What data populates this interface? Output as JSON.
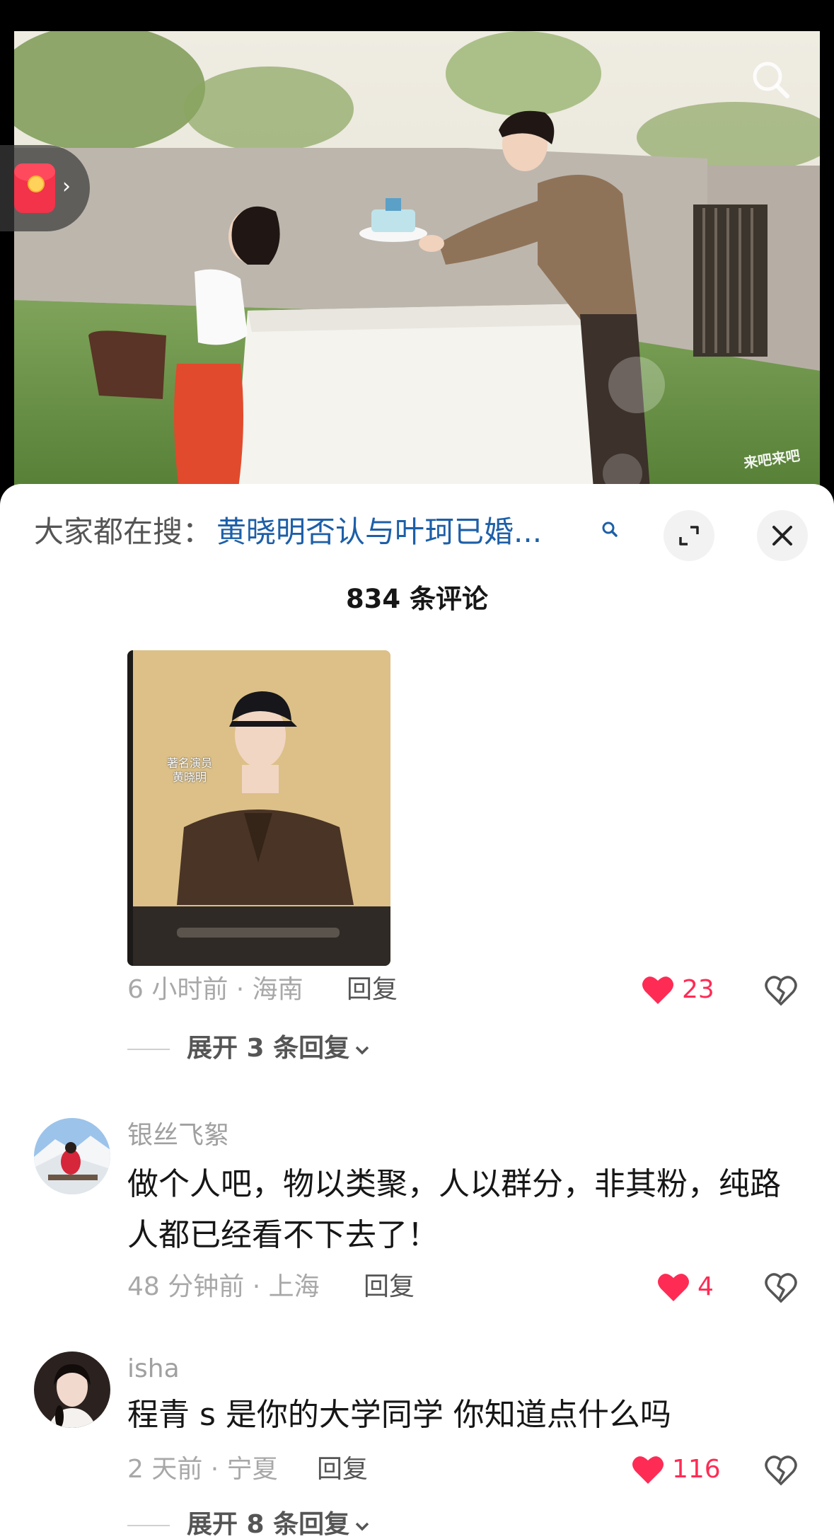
{
  "video": {
    "watermark": "来吧来吧"
  },
  "search": {
    "prefix": "大家都在搜：",
    "term": "黄晓明否认与叶珂已婚..."
  },
  "comments_header": {
    "count_label": "834 条评论"
  },
  "comments": [
    {
      "image_caption": "著名演员\n黄晓明",
      "meta": "6 小时前 · 海南",
      "reply_label": "回复",
      "likes": "23",
      "expand_label": "展开 3 条回复"
    },
    {
      "username": "银丝飞絮",
      "text": "做个人吧，物以类聚，人以群分，非其粉，纯路人都已经看不下去了！",
      "meta": "48 分钟前 · 上海",
      "reply_label": "回复",
      "likes": "4"
    },
    {
      "username": "isha",
      "text": "程青 s 是你的大学同学 你知道点什么吗",
      "meta": "2 天前 · 宁夏",
      "reply_label": "回复",
      "likes": "116",
      "expand_label": "展开 8 条回复"
    }
  ],
  "colors": {
    "accent_like": "#fe2c55",
    "search_term": "#1d5fa8"
  }
}
